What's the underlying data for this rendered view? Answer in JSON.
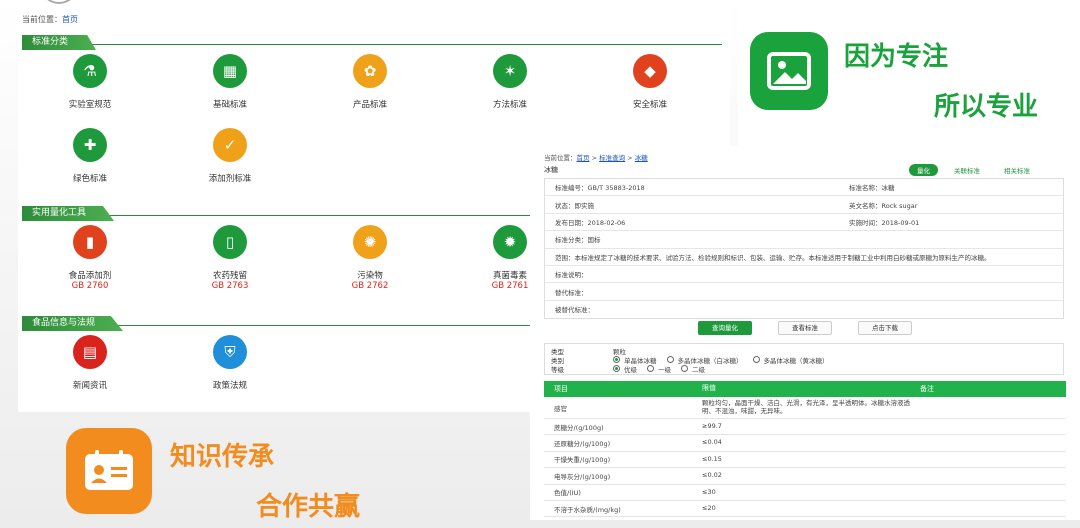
{
  "home": {
    "crumb_prefix": "当前位置：",
    "crumb_link": "首页",
    "sections": [
      {
        "title": "标准分类"
      },
      {
        "title": "实用量化工具"
      },
      {
        "title": "食品信息与法规"
      }
    ],
    "categories": [
      {
        "label": "实验室规范",
        "icon": "flask-icon",
        "color": "#1e9a3c"
      },
      {
        "label": "基础标准",
        "icon": "grid-icon",
        "color": "#1e9a3c"
      },
      {
        "label": "产品标准",
        "icon": "product-icon",
        "color": "#f0a11a"
      },
      {
        "label": "方法标准",
        "icon": "network-icon",
        "color": "#1e9a3c"
      },
      {
        "label": "安全标准",
        "icon": "shield-icon",
        "color": "#e0421e"
      },
      {
        "label": "绿色标准",
        "icon": "medkit-icon",
        "color": "#1e9a3c"
      },
      {
        "label": "添加剂标准",
        "icon": "spoon-icon",
        "color": "#f0a11a"
      }
    ],
    "tools": [
      {
        "label": "食品添加剂",
        "code": "GB 2760",
        "icon": "bottle-icon"
      },
      {
        "label": "农药残留",
        "code": "GB 2763",
        "icon": "pesticide-icon"
      },
      {
        "label": "污染物",
        "code": "GB 2762",
        "icon": "pollutant-icon"
      },
      {
        "label": "真菌毒素",
        "code": "GB 2761",
        "icon": "fungus-icon"
      }
    ],
    "regs": [
      {
        "label": "新闻资讯",
        "icon": "news-icon"
      },
      {
        "label": "政策法规",
        "icon": "law-icon"
      }
    ]
  },
  "promo": {
    "top_line1": "因为专注",
    "top_line2": "所以专业",
    "bottom_line1": "知识传承",
    "bottom_line2": "合作共赢",
    "green": "#1aa23c",
    "orange": "#f28c1e"
  },
  "detail": {
    "crumb_prefix": "当前位置：",
    "crumb_links": [
      "首页",
      "标准查询",
      "冰糖"
    ],
    "title": "冰糖",
    "tabs": [
      "量化",
      "关联标准",
      "相关标准"
    ],
    "info": {
      "std_no_label": "标准编号：",
      "std_no": "GB/T 35883-2018",
      "std_name_label": "标准名称：",
      "std_name": "冰糖",
      "status_label": "状态：",
      "status": "即实施",
      "en_name_label": "英文名称：",
      "en_name": "Rock sugar",
      "pub_label": "发布日期：",
      "pub": "2018-02-06",
      "impl_label": "实施时间：",
      "impl": "2018-09-01",
      "class_label": "标准分类：",
      "class": "国标",
      "scope_label": "范围：",
      "scope": "本标准规定了冰糖的技术要求、试验方法、检验规则和标识、包装、运输、贮存。本标准适用于制糖工业中利用白砂糖或原糖为原料生产的冰糖。",
      "desc_label": "标准说明：",
      "replace_label": "替代标准：",
      "replaced_label": "被替代标准："
    },
    "buttons": [
      "查询量化",
      "查看标准",
      "点击下载"
    ],
    "filters": {
      "type_label": "类型",
      "type_value": "颗粒",
      "cat_label": "类别",
      "cat_options": [
        "单晶体冰糖",
        "多晶体冰糖（白冰糖）",
        "多晶体冰糖（黄冰糖）"
      ],
      "grade_label": "等级",
      "grade_options": [
        "优级",
        "一级",
        "二级"
      ]
    },
    "table": {
      "headers": [
        "项目",
        "限值",
        "备注"
      ],
      "rows": [
        [
          "感官",
          "颗粒均匀，晶面干燥、洁白、光滑，有光泽，呈半透明体。冰糖水溶液透明、不混浊，味甜，无异味。",
          ""
        ],
        [
          "蔗糖分/(g/100g)",
          "≥99.7",
          ""
        ],
        [
          "还原糖分/(g/100g)",
          "≤0.04",
          ""
        ],
        [
          "干燥失重/(g/100g)",
          "≤0.15",
          ""
        ],
        [
          "电导灰分/(g/100g)",
          "≤0.02",
          ""
        ],
        [
          "色值/(IU)",
          "≤30",
          ""
        ],
        [
          "不溶于水杂质/(mg/kg)",
          "≤20",
          ""
        ]
      ]
    }
  }
}
